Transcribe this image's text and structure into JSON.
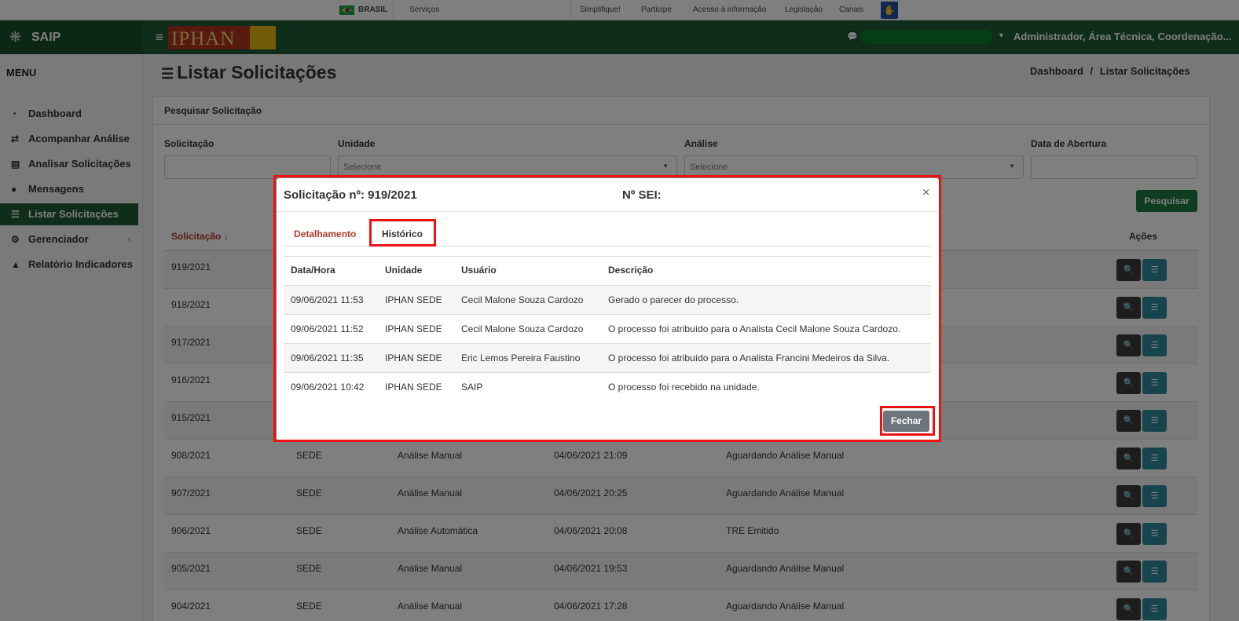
{
  "gov_bar": {
    "country": "BRASIL",
    "services": "Serviços",
    "links": [
      "Simplifique!",
      "Participe",
      "Acesso à informação",
      "Legislação",
      "Canais"
    ]
  },
  "header": {
    "app_name": "SAIP",
    "logo_text": "IPHAN",
    "user": "Administrador, Área Técnica, Coordenação..."
  },
  "sidebar": {
    "title": "MENU",
    "items": [
      {
        "label": "Dashboard",
        "icon": "tachometer-icon"
      },
      {
        "label": "Acompanhar Análise",
        "icon": "exchange-icon"
      },
      {
        "label": "Analisar Solicitações",
        "icon": "book-icon"
      },
      {
        "label": "Mensagens",
        "icon": "comments-icon"
      },
      {
        "label": "Listar Solicitações",
        "icon": "list-icon",
        "active": true
      },
      {
        "label": "Gerenciador",
        "icon": "cogs-icon"
      },
      {
        "label": "Relatório Indicadores",
        "icon": "area-chart-icon"
      }
    ]
  },
  "page": {
    "title": "Listar Solicitações",
    "breadcrumb": [
      "Dashboard",
      "/",
      "Listar Solicitações"
    ]
  },
  "search": {
    "panel_title": "Pesquisar Solicitação",
    "labels": {
      "solicitacao": "Solicitação",
      "unidade": "Unidade",
      "analise": "Análise",
      "data": "Data de Abertura"
    },
    "unidade_value": "Selecione",
    "analise_value": "Selecione",
    "button": "Pesquisar"
  },
  "table": {
    "headers": {
      "solicitacao": "Solicitação",
      "acoes": "Ações"
    },
    "rows": [
      {
        "num": "919/2021",
        "unidade": "",
        "analise": "",
        "data": "",
        "situacao": ""
      },
      {
        "num": "918/2021",
        "unidade": "",
        "analise": "",
        "data": "",
        "situacao": ""
      },
      {
        "num": "917/2021",
        "unidade": "",
        "analise": "",
        "data": "",
        "situacao": ""
      },
      {
        "num": "916/2021",
        "unidade": "",
        "analise": "",
        "data": "",
        "situacao": ""
      },
      {
        "num": "915/2021",
        "unidade": "",
        "analise": "",
        "data": "",
        "situacao": ""
      },
      {
        "num": "908/2021",
        "unidade": "SEDE",
        "analise": "Análise Manual",
        "data": "04/06/2021 21:09",
        "situacao": "Aguardando Análise Manual"
      },
      {
        "num": "907/2021",
        "unidade": "SEDE",
        "analise": "Análise Manual",
        "data": "04/06/2021 20:25",
        "situacao": "Aguardando Análise Manual"
      },
      {
        "num": "906/2021",
        "unidade": "SEDE",
        "analise": "Análise Automática",
        "data": "04/06/2021 20:08",
        "situacao": "TRE Emitido"
      },
      {
        "num": "905/2021",
        "unidade": "SEDE",
        "analise": "Análise Manual",
        "data": "04/06/2021 19:53",
        "situacao": "Aguardando Análise Manual"
      },
      {
        "num": "904/2021",
        "unidade": "SEDE",
        "analise": "Análise Manual",
        "data": "04/06/2021 17:28",
        "situacao": "Aguardando Análise Manual"
      }
    ]
  },
  "modal": {
    "title": "Solicitação nº: 919/2021",
    "sei": "Nº SEI:",
    "close": "×",
    "tabs": [
      "Detalhamento",
      "Histórico"
    ],
    "history_headers": [
      "Data/Hora",
      "Unidade",
      "Usuário",
      "Descrição"
    ],
    "history": [
      {
        "data": "09/06/2021 11:53",
        "unidade": "IPHAN SEDE",
        "usuario": "Cecil Malone Souza Cardozo",
        "descricao": "Gerado o parecer do processo."
      },
      {
        "data": "09/06/2021 11:52",
        "unidade": "IPHAN SEDE",
        "usuario": "Cecil Malone Souza Cardozo",
        "descricao": "O processo foi atribuído para o Analista Cecil Malone Souza Cardozo."
      },
      {
        "data": "09/06/2021 11:35",
        "unidade": "IPHAN SEDE",
        "usuario": "Eric Lemos Pereira Faustino",
        "descricao": "O processo foi atribuído para o Analista Francini Medeiros da Silva."
      },
      {
        "data": "09/06/2021 10:42",
        "unidade": "IPHAN SEDE",
        "usuario": "SAIP",
        "descricao": "O processo foi recebido na unidade."
      }
    ],
    "close_button": "Fechar"
  },
  "colors": {
    "brand_green": "#1f5a34",
    "highlight": "#ee1111",
    "accent_red": "#b33a2b"
  }
}
